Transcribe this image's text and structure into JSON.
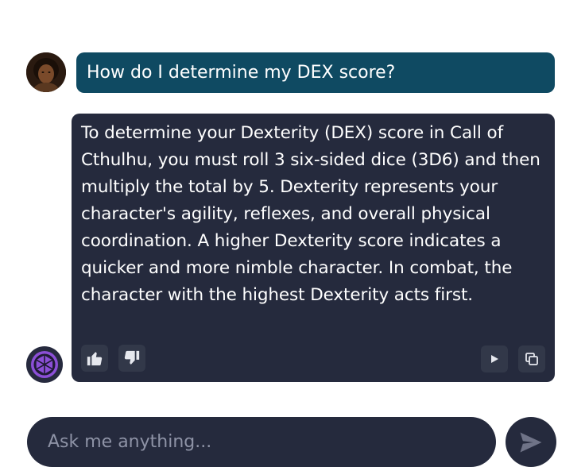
{
  "conversation": {
    "user_message": "How do I determine my DEX score?",
    "assistant_message": "To determine your Dexterity (DEX) score in Call of Cthulhu, you must roll 3 six-sided dice (3D6) and then multiply the total by 5. Dexterity represents your character's agility, reflexes, and overall physical coordination. A higher Dexterity score indicates a quicker and more nimble character. In combat, the character with the highest Dexterity acts first."
  },
  "actions": {
    "like_icon": "thumbs-up-icon",
    "dislike_icon": "thumbs-down-icon",
    "play_icon": "play-icon",
    "copy_icon": "copy-icon"
  },
  "composer": {
    "placeholder": "Ask me anything...",
    "value": "",
    "send_icon": "send-icon"
  },
  "colors": {
    "user_bubble": "#0f4a62",
    "assistant_bubble": "#252a3d",
    "assistant_logo": "#8b4fd6"
  }
}
